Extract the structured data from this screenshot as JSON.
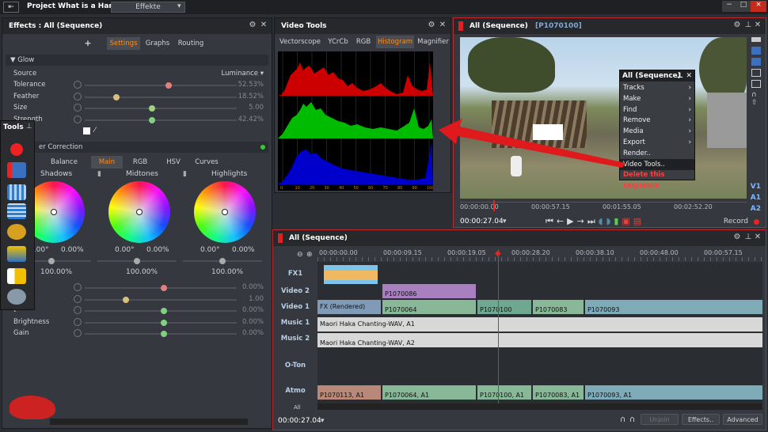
{
  "titlebar": {
    "project": "Project What is a Hangi",
    "layout": "Effekte"
  },
  "effects": {
    "title": "Effects : All (Sequence)",
    "plus": "+",
    "tabs": [
      "Settings",
      "Graphs",
      "Routing"
    ],
    "glow": {
      "header": "▼ Glow",
      "source_label": "Source",
      "source_value": "Luminance",
      "rows": [
        {
          "label": "Tolerance",
          "value": "52.53%",
          "pos": 0.53,
          "color": "#e08080"
        },
        {
          "label": "Feather",
          "value": "18.52%",
          "pos": 0.19,
          "color": "#d8c080"
        },
        {
          "label": "Size",
          "value": "5.00",
          "pos": 0.42,
          "color": "#a0d080"
        },
        {
          "label": "Strength",
          "value": "42.42%",
          "pos": 0.42,
          "color": "#80d080"
        }
      ]
    },
    "color_correction": {
      "header": "er Correction",
      "tabs": [
        "Balance",
        "Main",
        "RGB",
        "HSV",
        "Curves"
      ],
      "wheels": [
        {
          "name": "Shadows",
          "deg": "0.00°",
          "pct": "0.00%",
          "sat": "100.00%"
        },
        {
          "name": "Midtones",
          "deg": "0.00°",
          "pct": "0.00%",
          "sat": "100.00%"
        },
        {
          "name": "Highlights",
          "deg": "0.00°",
          "pct": "0.00%",
          "sat": "100.00%"
        }
      ],
      "rows": [
        {
          "label": "ion",
          "value": "0.00%",
          "pos": 0.5,
          "color": "#e08080"
        },
        {
          "label": "",
          "value": "1.00",
          "pos": 0.25,
          "color": "#d8c080"
        },
        {
          "label": "t",
          "value": "0.00%",
          "pos": 0.5,
          "color": "#80d080"
        },
        {
          "label": "Brightness",
          "value": "0.00%",
          "pos": 0.5,
          "color": "#80d080"
        },
        {
          "label": "Gain",
          "value": "0.00%",
          "pos": 0.5,
          "color": "#80d080"
        }
      ]
    }
  },
  "tools": {
    "title": "Tools"
  },
  "videotools": {
    "title": "Video Tools",
    "tabs": [
      "Vectorscope",
      "YCrCb",
      "RGB",
      "Histogram",
      "Magnifier"
    ],
    "active": "Histogram",
    "axis": [
      "0",
      "10",
      "20",
      "30",
      "40",
      "50",
      "60",
      "70",
      "80",
      "90",
      "100"
    ]
  },
  "viewer": {
    "title": "All (Sequence)",
    "clip": "[P1070100]",
    "timecodes": [
      "00:00:00.00",
      "00:00:57.15",
      "00:01:55.05",
      "00:02:52.20"
    ],
    "current": "00:00:27.04",
    "record": "Record",
    "tracks": [
      "V1",
      "A1",
      "A2"
    ]
  },
  "menu": {
    "title": "All (Sequence)",
    "items": [
      {
        "label": "Tracks",
        "sub": true
      },
      {
        "label": "Make",
        "sub": true
      },
      {
        "label": "Find",
        "sub": true
      },
      {
        "label": "Remove",
        "sub": true
      },
      {
        "label": "Media",
        "sub": true
      },
      {
        "label": "Export",
        "sub": true
      },
      {
        "label": "Render..",
        "sub": false
      },
      {
        "label": "Video Tools..",
        "sub": false
      },
      {
        "label": "Delete this sequence",
        "sub": false
      }
    ]
  },
  "timeline": {
    "title": "All (Sequence)",
    "ruler": [
      "00:00:00.00",
      "00:00:09.15",
      "00:00:19.05",
      "00:00:28.20",
      "00:00:38.10",
      "00:00:48.00",
      "00:00:57.15"
    ],
    "tracks": [
      "FX1",
      "Video 2",
      "Video 1",
      "Music 1",
      "Music 2",
      "O-Ton",
      "Atmo"
    ],
    "clips": {
      "v2": "P1070086",
      "v1": [
        "FX (Rendered)",
        "P1070064",
        "P1070100",
        "P1070083",
        "P1070093"
      ],
      "m1": "Maori Haka Chanting-WAV, A1",
      "m2": "Maori Haka Chanting-WAV, A2",
      "atmo": [
        "P1070113, A1",
        "P1070064, A1",
        "P1070100, A1",
        "P1070083, A1",
        "P1070093, A1"
      ]
    },
    "all": "All",
    "current": "00:00:27.04",
    "buttons": [
      "Unjoin",
      "Effects..",
      "Advanced"
    ]
  }
}
